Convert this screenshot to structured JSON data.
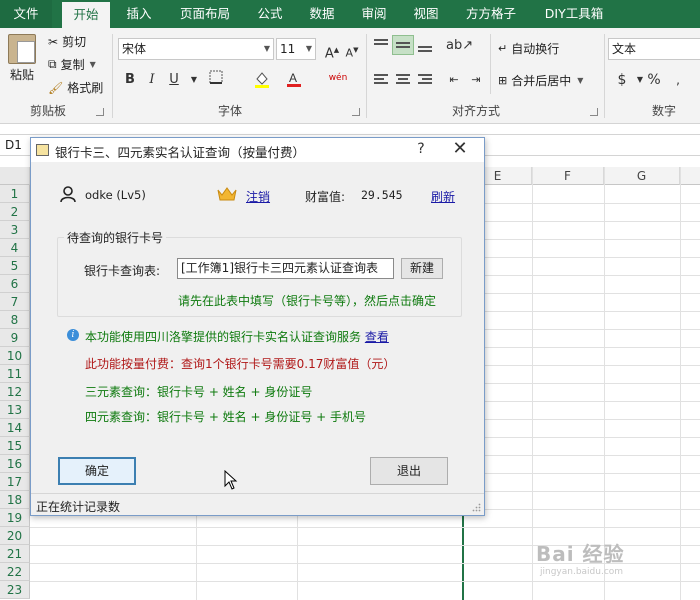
{
  "ribbon_tabs": [
    "文件",
    "开始",
    "插入",
    "页面布局",
    "公式",
    "数据",
    "审阅",
    "视图",
    "方方格子",
    "DIY工具箱"
  ],
  "clipboard": {
    "paste": "粘贴",
    "cut": "剪切",
    "copy": "复制",
    "format_painter": "格式刷",
    "group_label": "剪贴板"
  },
  "font": {
    "font_name": "宋体",
    "font_size": "11",
    "bold": "B",
    "italic": "I",
    "underline": "U",
    "group_label": "字体",
    "phonetic": "wén"
  },
  "alignment": {
    "wrap_text": "自动换行",
    "merge_center": "合并后居中",
    "group_label": "对齐方式"
  },
  "number": {
    "format": "文本",
    "currency": "$",
    "percent": "%",
    "group_label": "数字"
  },
  "name_box": "D1",
  "columns": [
    "E",
    "F",
    "G"
  ],
  "rows": [
    "1",
    "2",
    "3",
    "4",
    "5",
    "6",
    "7",
    "8",
    "9",
    "10",
    "11",
    "12",
    "13",
    "14",
    "15",
    "16",
    "17",
    "18",
    "19",
    "20",
    "21",
    "22",
    "23"
  ],
  "dialog": {
    "title": "银行卡三、四元素实名认证查询（按量付费）",
    "help": "?",
    "close": "✕",
    "user": "odke (Lv5)",
    "logout": "注销",
    "wealth_label": "财富值:",
    "wealth_value": "29.545",
    "refresh": "刷新",
    "group_title": "待查询的银行卡号",
    "table_label": "银行卡查询表:",
    "table_value": "[工作簿1]银行卡三四元素认证查询表",
    "new_button": "新建",
    "hint": "请先在此表中填写（银行卡号等），然后点击确定",
    "info": "本功能使用四川洛擎提供的银行卡实名认证查询服务",
    "info_link": "查看",
    "pricing": "此功能按量付费：查询1个银行卡号需要0.17财富值（元）",
    "three_element": "三元素查询：银行卡号 + 姓名 + 身份证号",
    "four_element": "四元素查询：银行卡号 + 姓名 + 身份证号 + 手机号",
    "ok": "确定",
    "exit": "退出",
    "status": "正在统计记录数"
  },
  "watermark": "Bai 经验",
  "watermark_sub": "jingyan.baidu.com",
  "colors": {
    "excel_green": "#217346",
    "hint_green": "#0e7a0e",
    "price_red": "#b01818",
    "link_blue": "#1a1aa6"
  }
}
